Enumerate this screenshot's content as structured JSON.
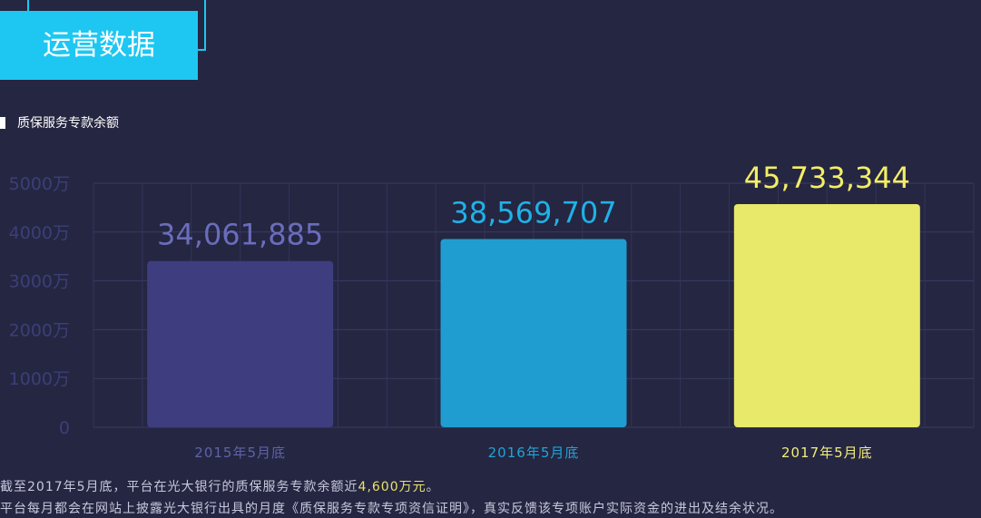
{
  "header": {
    "title": "运营数据"
  },
  "section": {
    "title": "质保服务专款余额"
  },
  "chart_data": {
    "type": "bar",
    "title": "质保服务专款余额",
    "categories": [
      "2015年5月底",
      "2016年5月底",
      "2017年5月底"
    ],
    "values": [
      34061885,
      38569707,
      45733344
    ],
    "value_labels": [
      "34,061,885",
      "38,569,707",
      "45,733,344"
    ],
    "colors": [
      "#3e3d7f",
      "#1f9dd1",
      "#e8e86a"
    ],
    "label_colors": [
      "#6a6dbb",
      "#1fb1e8",
      "#f2ee66"
    ],
    "category_label_colors": [
      "#5f62a8",
      "#1fa4d8",
      "#f0ec7a"
    ],
    "ylim": [
      0,
      50000000
    ],
    "y_ticks": [
      0,
      10000000,
      20000000,
      30000000,
      40000000,
      50000000
    ],
    "y_tick_labels": [
      "0",
      "1000万",
      "2000万",
      "3000万",
      "4000万",
      "5000万"
    ],
    "grid": true,
    "legend": false
  },
  "footer": {
    "line1_prefix": "截至2017年5月底，平台在光大银行的质保服务专款余额近",
    "line1_highlight": "4,600万元",
    "line1_suffix": "。",
    "line2": "平台每月都会在网站上披露光大银行出具的月度《质保服务专款专项资信证明》，真实反馈该专项账户实际资金的进出及结余状况。"
  }
}
